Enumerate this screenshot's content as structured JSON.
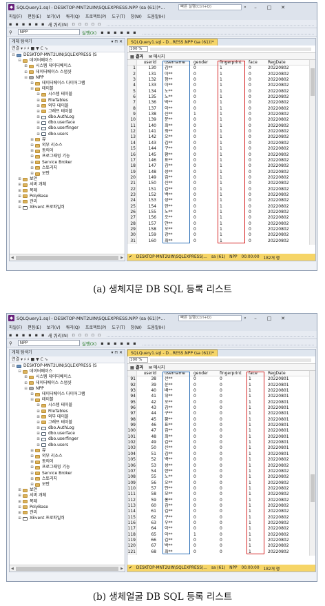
{
  "panels": [
    {
      "id": "a",
      "title": "SQLQuery1.sql - DESKTOP-MNT2UIN\\SQLEXPRESS.NPP (sa (61))*...",
      "search_placeholder": "빠른 실행(Ctrl+Q)",
      "menu": [
        "파일(F)",
        "편집(E)",
        "보기(V)",
        "쿼리(Q)",
        "프로젝트(P)",
        "도구(T)",
        "창(W)",
        "도움말(H)"
      ],
      "toolbar1_items": [
        "새 쿼리(N)"
      ],
      "db_selector": "NPP",
      "execute_label": "실행(X)",
      "explorer_title": "개체 탐색기",
      "explorer_toolbar": "연결 ▾ ♯ ♯ ■ ▼ C ∿",
      "tree": [
        {
          "level": 0,
          "icon": "server",
          "expand": "⊟",
          "label": "DESKTOP-MNT2UIN\\SQLEXPRESS (S"
        },
        {
          "level": 1,
          "icon": "folder",
          "expand": "⊟",
          "label": "데이터베이스"
        },
        {
          "level": 2,
          "icon": "folder",
          "expand": "⊞",
          "label": "시스템 데이터베이스"
        },
        {
          "level": 2,
          "icon": "folder",
          "expand": "⊞",
          "label": "데이터베이스 스냅샷"
        },
        {
          "level": 2,
          "icon": "db",
          "expand": "⊟",
          "label": "NPP"
        },
        {
          "level": 3,
          "icon": "folder",
          "expand": "⊞",
          "label": "데이터베이스 다이어그램"
        },
        {
          "level": 3,
          "icon": "folder",
          "expand": "⊟",
          "label": "테이블"
        },
        {
          "level": 4,
          "icon": "folder",
          "expand": "⊞",
          "label": "시스템 테이블"
        },
        {
          "level": 4,
          "icon": "folder",
          "expand": "⊞",
          "label": "FileTables"
        },
        {
          "level": 4,
          "icon": "folder",
          "expand": "⊞",
          "label": "외부 테이블"
        },
        {
          "level": 4,
          "icon": "folder",
          "expand": "⊞",
          "label": "그래프 테이블"
        },
        {
          "level": 4,
          "icon": "table",
          "expand": "⊞",
          "label": "dbo.AuthLog"
        },
        {
          "level": 4,
          "icon": "table",
          "expand": "⊞",
          "label": "dbo.userface"
        },
        {
          "level": 4,
          "icon": "table",
          "expand": "⊞",
          "label": "dbo.userfinger"
        },
        {
          "level": 4,
          "icon": "table",
          "expand": "⊞",
          "label": "dbo.users"
        },
        {
          "level": 3,
          "icon": "folder",
          "expand": "⊞",
          "label": "뷰"
        },
        {
          "level": 3,
          "icon": "folder",
          "expand": "⊞",
          "label": "외부 리소스"
        },
        {
          "level": 3,
          "icon": "folder",
          "expand": "⊞",
          "label": "동의어"
        },
        {
          "level": 3,
          "icon": "folder",
          "expand": "⊞",
          "label": "프로그래밍 기능"
        },
        {
          "level": 3,
          "icon": "folder",
          "expand": "⊞",
          "label": "Service Broker"
        },
        {
          "level": 3,
          "icon": "folder",
          "expand": "⊞",
          "label": "스토리지"
        },
        {
          "level": 3,
          "icon": "folder",
          "expand": "⊞",
          "label": "보안"
        },
        {
          "level": 1,
          "icon": "folder",
          "expand": "⊞",
          "label": "보안"
        },
        {
          "level": 1,
          "icon": "folder",
          "expand": "⊞",
          "label": "서버 개체"
        },
        {
          "level": 1,
          "icon": "folder",
          "expand": "⊞",
          "label": "복제"
        },
        {
          "level": 1,
          "icon": "folder",
          "expand": "⊞",
          "label": "PolyBase"
        },
        {
          "level": 1,
          "icon": "folder",
          "expand": "⊞",
          "label": "관리"
        },
        {
          "level": 1,
          "icon": "xe",
          "expand": "⊞",
          "label": "XEvent 프로파일러"
        }
      ],
      "doc_tab": "SQLQuery1.sql - D...RESS.NPP (sa (61))*",
      "zoom": "100 %",
      "result_tabs": [
        "결과",
        "메시지"
      ],
      "columns": [
        "userid",
        "username",
        "gender",
        "fingerprint",
        "face",
        "RegDate"
      ],
      "rows": [
        [
          "1",
          "130",
          "김**",
          "0",
          "1",
          "0",
          "20220802"
        ],
        [
          "2",
          "131",
          "이**",
          "0",
          "1",
          "0",
          "20220802"
        ],
        [
          "3",
          "132",
          "정**",
          "0",
          "1",
          "0",
          "20220802"
        ],
        [
          "4",
          "133",
          "이**",
          "0",
          "1",
          "0",
          "20220802"
        ],
        [
          "5",
          "134",
          "노**",
          "0",
          "1",
          "0",
          "20220802"
        ],
        [
          "6",
          "135",
          "노**",
          "0",
          "1",
          "0",
          "20220802"
        ],
        [
          "7",
          "136",
          "박**",
          "0",
          "1",
          "0",
          "20220802"
        ],
        [
          "8",
          "137",
          "이**",
          "0",
          "1",
          "0",
          "20220802"
        ],
        [
          "9",
          "138",
          "신**",
          "1",
          "1",
          "0",
          "20220802"
        ],
        [
          "10",
          "139",
          "문**",
          "0",
          "1",
          "0",
          "20220802"
        ],
        [
          "11",
          "140",
          "최**",
          "0",
          "1",
          "0",
          "20220802"
        ],
        [
          "12",
          "141",
          "최**",
          "0",
          "1",
          "0",
          "20220802"
        ],
        [
          "13",
          "142",
          "오**",
          "0",
          "1",
          "0",
          "20220802"
        ],
        [
          "14",
          "143",
          "김**",
          "0",
          "1",
          "0",
          "20220802"
        ],
        [
          "15",
          "144",
          "구**",
          "0",
          "1",
          "0",
          "20220802"
        ],
        [
          "16",
          "145",
          "황**",
          "0",
          "1",
          "0",
          "20220802"
        ],
        [
          "17",
          "146",
          "표**",
          "0",
          "1",
          "0",
          "20220802"
        ],
        [
          "18",
          "147",
          "김**",
          "0",
          "1",
          "0",
          "20220802"
        ],
        [
          "19",
          "148",
          "성**",
          "0",
          "1",
          "0",
          "20220802"
        ],
        [
          "20",
          "149",
          "김**",
          "0",
          "1",
          "0",
          "20220802"
        ],
        [
          "21",
          "150",
          "신**",
          "0",
          "1",
          "0",
          "20220802"
        ],
        [
          "22",
          "151",
          "김**",
          "0",
          "1",
          "0",
          "20220802"
        ],
        [
          "23",
          "152",
          "백**",
          "0",
          "1",
          "0",
          "20220802"
        ],
        [
          "24",
          "153",
          "성**",
          "0",
          "1",
          "0",
          "20220802"
        ],
        [
          "25",
          "154",
          "한**",
          "0",
          "1",
          "0",
          "20220802"
        ],
        [
          "26",
          "155",
          "노**",
          "0",
          "1",
          "0",
          "20220802"
        ],
        [
          "27",
          "156",
          "오**",
          "0",
          "1",
          "0",
          "20220802"
        ],
        [
          "28",
          "157",
          "안**",
          "0",
          "1",
          "0",
          "20220802"
        ],
        [
          "29",
          "158",
          "오**",
          "0",
          "1",
          "0",
          "20220802"
        ],
        [
          "30",
          "159",
          "강**",
          "0",
          "1",
          "0",
          "20220802"
        ],
        [
          "31",
          "160",
          "최**",
          "0",
          "1",
          "0",
          "20220802"
        ]
      ],
      "highlight_cols": [
        2,
        4
      ],
      "status": [
        "DESKTOP-MNT2UIN\\SQLEXPRESS(...",
        "sa (61)",
        "NPP",
        "00:00:00",
        "182개 행"
      ],
      "caption": "(a) 생체지문 DB SQL 등록 리스트"
    },
    {
      "id": "b",
      "title": "SQLQuery1.sql - DESKTOP-MNT2UIN\\SQLEXPRESS.NPP (sa (61))*...",
      "search_placeholder": "빠른 실행(Ctrl+Q)",
      "menu": [
        "파일(F)",
        "편집(E)",
        "보기(V)",
        "쿼리(Q)",
        "프로젝트(P)",
        "도구(T)",
        "창(W)",
        "도움말(H)"
      ],
      "toolbar1_items": [
        "새 쿼리(N)"
      ],
      "db_selector": "NPP",
      "execute_label": "실행(X)",
      "explorer_title": "개체 탐색기",
      "explorer_toolbar": "연결 ▾ ♯ ♯ ■ ▼ C ∿",
      "tree": [
        {
          "level": 0,
          "icon": "server",
          "expand": "⊟",
          "label": "DESKTOP-MNT2UIN\\SQLEXPRESS (S"
        },
        {
          "level": 1,
          "icon": "folder",
          "expand": "⊟",
          "label": "데이터베이스"
        },
        {
          "level": 2,
          "icon": "folder",
          "expand": "⊞",
          "label": "시스템 데이터베이스"
        },
        {
          "level": 2,
          "icon": "folder",
          "expand": "⊞",
          "label": "데이터베이스 스냅샷"
        },
        {
          "level": 2,
          "icon": "db",
          "expand": "⊟",
          "label": "NPP"
        },
        {
          "level": 3,
          "icon": "folder",
          "expand": "⊞",
          "label": "데이터베이스 다이어그램"
        },
        {
          "level": 3,
          "icon": "folder",
          "expand": "⊟",
          "label": "테이블"
        },
        {
          "level": 4,
          "icon": "folder",
          "expand": "⊞",
          "label": "시스템 테이블"
        },
        {
          "level": 4,
          "icon": "folder",
          "expand": "⊞",
          "label": "FileTables"
        },
        {
          "level": 4,
          "icon": "folder",
          "expand": "⊞",
          "label": "외부 테이블"
        },
        {
          "level": 4,
          "icon": "folder",
          "expand": "⊞",
          "label": "그래프 테이블"
        },
        {
          "level": 4,
          "icon": "table",
          "expand": "⊞",
          "label": "dbo.AuthLog"
        },
        {
          "level": 4,
          "icon": "table",
          "expand": "⊞",
          "label": "dbo.userface"
        },
        {
          "level": 4,
          "icon": "table",
          "expand": "⊞",
          "label": "dbo.userfinger"
        },
        {
          "level": 4,
          "icon": "table",
          "expand": "⊞",
          "label": "dbo.users"
        },
        {
          "level": 3,
          "icon": "folder",
          "expand": "⊞",
          "label": "뷰"
        },
        {
          "level": 3,
          "icon": "folder",
          "expand": "⊞",
          "label": "외부 리소스"
        },
        {
          "level": 3,
          "icon": "folder",
          "expand": "⊞",
          "label": "동의어"
        },
        {
          "level": 3,
          "icon": "folder",
          "expand": "⊞",
          "label": "프로그래밍 기능"
        },
        {
          "level": 3,
          "icon": "folder",
          "expand": "⊞",
          "label": "Service Broker"
        },
        {
          "level": 3,
          "icon": "folder",
          "expand": "⊞",
          "label": "스토리지"
        },
        {
          "level": 3,
          "icon": "folder",
          "expand": "⊞",
          "label": "보안"
        },
        {
          "level": 1,
          "icon": "folder",
          "expand": "⊞",
          "label": "보안"
        },
        {
          "level": 1,
          "icon": "folder",
          "expand": "⊞",
          "label": "서버 개체"
        },
        {
          "level": 1,
          "icon": "folder",
          "expand": "⊞",
          "label": "복제"
        },
        {
          "level": 1,
          "icon": "folder",
          "expand": "⊞",
          "label": "PolyBase"
        },
        {
          "level": 1,
          "icon": "folder",
          "expand": "⊞",
          "label": "관리"
        },
        {
          "level": 1,
          "icon": "xe",
          "expand": "⊞",
          "label": "XEvent 프로파일러"
        }
      ],
      "doc_tab": "SQLQuery1.sql - D...RESS.NPP (sa (61))*",
      "zoom": "100 %",
      "result_tabs": [
        "결과",
        "메시지"
      ],
      "columns": [
        "userid",
        "username",
        "gender",
        "fingerprint",
        "face",
        "RegDate"
      ],
      "rows": [
        [
          "91",
          "38",
          "선**",
          "0",
          "0",
          "1",
          "20220801"
        ],
        [
          "92",
          "39",
          "윤**",
          "0",
          "0",
          "1",
          "20220801"
        ],
        [
          "93",
          "40",
          "배**",
          "0",
          "0",
          "1",
          "20220801"
        ],
        [
          "94",
          "41",
          "위**",
          "0",
          "0",
          "1",
          "20220801"
        ],
        [
          "95",
          "42",
          "오**",
          "0",
          "0",
          "1",
          "20220801"
        ],
        [
          "96",
          "43",
          "김**",
          "0",
          "0",
          "1",
          "20220801"
        ],
        [
          "97",
          "44",
          "구**",
          "0",
          "0",
          "1",
          "20220801"
        ],
        [
          "98",
          "45",
          "황**",
          "0",
          "0",
          "1",
          "20220801"
        ],
        [
          "99",
          "46",
          "표**",
          "0",
          "0",
          "1",
          "20220801"
        ],
        [
          "100",
          "47",
          "김**",
          "0",
          "0",
          "1",
          "20220801"
        ],
        [
          "101",
          "48",
          "최**",
          "0",
          "0",
          "1",
          "20220801"
        ],
        [
          "102",
          "49",
          "김**",
          "0",
          "0",
          "1",
          "20220801"
        ],
        [
          "103",
          "50",
          "신**",
          "0",
          "0",
          "1",
          "20220801"
        ],
        [
          "104",
          "51",
          "김**",
          "0",
          "0",
          "1",
          "20220801"
        ],
        [
          "105",
          "52",
          "백**",
          "0",
          "0",
          "1",
          "20220802"
        ],
        [
          "106",
          "53",
          "성**",
          "0",
          "0",
          "1",
          "20220802"
        ],
        [
          "107",
          "54",
          "한**",
          "0",
          "0",
          "1",
          "20220802"
        ],
        [
          "108",
          "55",
          "노**",
          "0",
          "0",
          "1",
          "20220802"
        ],
        [
          "109",
          "56",
          "오**",
          "0",
          "0",
          "1",
          "20220802"
        ],
        [
          "110",
          "57",
          "안**",
          "0",
          "0",
          "1",
          "20220802"
        ],
        [
          "111",
          "58",
          "모**",
          "0",
          "0",
          "1",
          "20220802"
        ],
        [
          "112",
          "59",
          "홍**",
          "0",
          "0",
          "1",
          "20220802"
        ],
        [
          "113",
          "60",
          "김**",
          "0",
          "0",
          "1",
          "20220802"
        ],
        [
          "114",
          "61",
          "김**",
          "0",
          "0",
          "1",
          "20220802"
        ],
        [
          "115",
          "62",
          "구**",
          "0",
          "0",
          "1",
          "20220802"
        ],
        [
          "116",
          "63",
          "우**",
          "0",
          "0",
          "1",
          "20220802"
        ],
        [
          "117",
          "64",
          "이**",
          "0",
          "0",
          "1",
          "20220802"
        ],
        [
          "118",
          "65",
          "이**",
          "1",
          "0",
          "1",
          "20220802"
        ],
        [
          "119",
          "66",
          "김**",
          "0",
          "0",
          "1",
          "20220802"
        ],
        [
          "120",
          "67",
          "박**",
          "0",
          "0",
          "1",
          "20220802"
        ],
        [
          "121",
          "68",
          "최**",
          "0",
          "0",
          "1",
          "20220802"
        ]
      ],
      "highlight_cols": [
        2,
        5
      ],
      "status": [
        "DESKTOP-MNT2UIN\\SQLEXPRESS(...",
        "sa (61)",
        "NPP",
        "00:00:00",
        "182개 행"
      ],
      "caption": "(b) 생체얼굴 DB SQL 등록 리스트"
    }
  ],
  "colors": {
    "accent_blue": "#2d6fb6",
    "accent_red": "#d42020",
    "status_yellow": "#f6d567"
  }
}
